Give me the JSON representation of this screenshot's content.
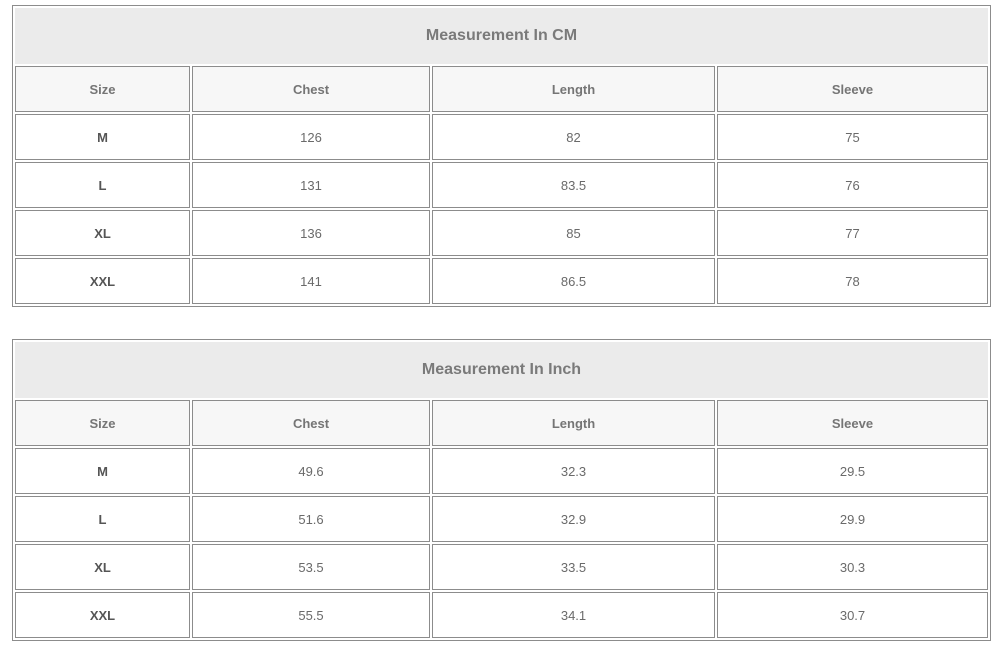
{
  "tables": [
    {
      "title": "Measurement In CM",
      "headers": [
        "Size",
        "Chest",
        "Length",
        "Sleeve"
      ],
      "rows": [
        [
          "M",
          "126",
          "82",
          "75"
        ],
        [
          "L",
          "131",
          "83.5",
          "76"
        ],
        [
          "XL",
          "136",
          "85",
          "77"
        ],
        [
          "XXL",
          "141",
          "86.5",
          "78"
        ]
      ]
    },
    {
      "title": "Measurement In Inch",
      "headers": [
        "Size",
        "Chest",
        "Length",
        "Sleeve"
      ],
      "rows": [
        [
          "M",
          "49.6",
          "32.3",
          "29.5"
        ],
        [
          "L",
          "51.6",
          "32.9",
          "29.9"
        ],
        [
          "XL",
          "53.5",
          "33.5",
          "30.3"
        ],
        [
          "XXL",
          "55.5",
          "34.1",
          "30.7"
        ]
      ]
    }
  ]
}
